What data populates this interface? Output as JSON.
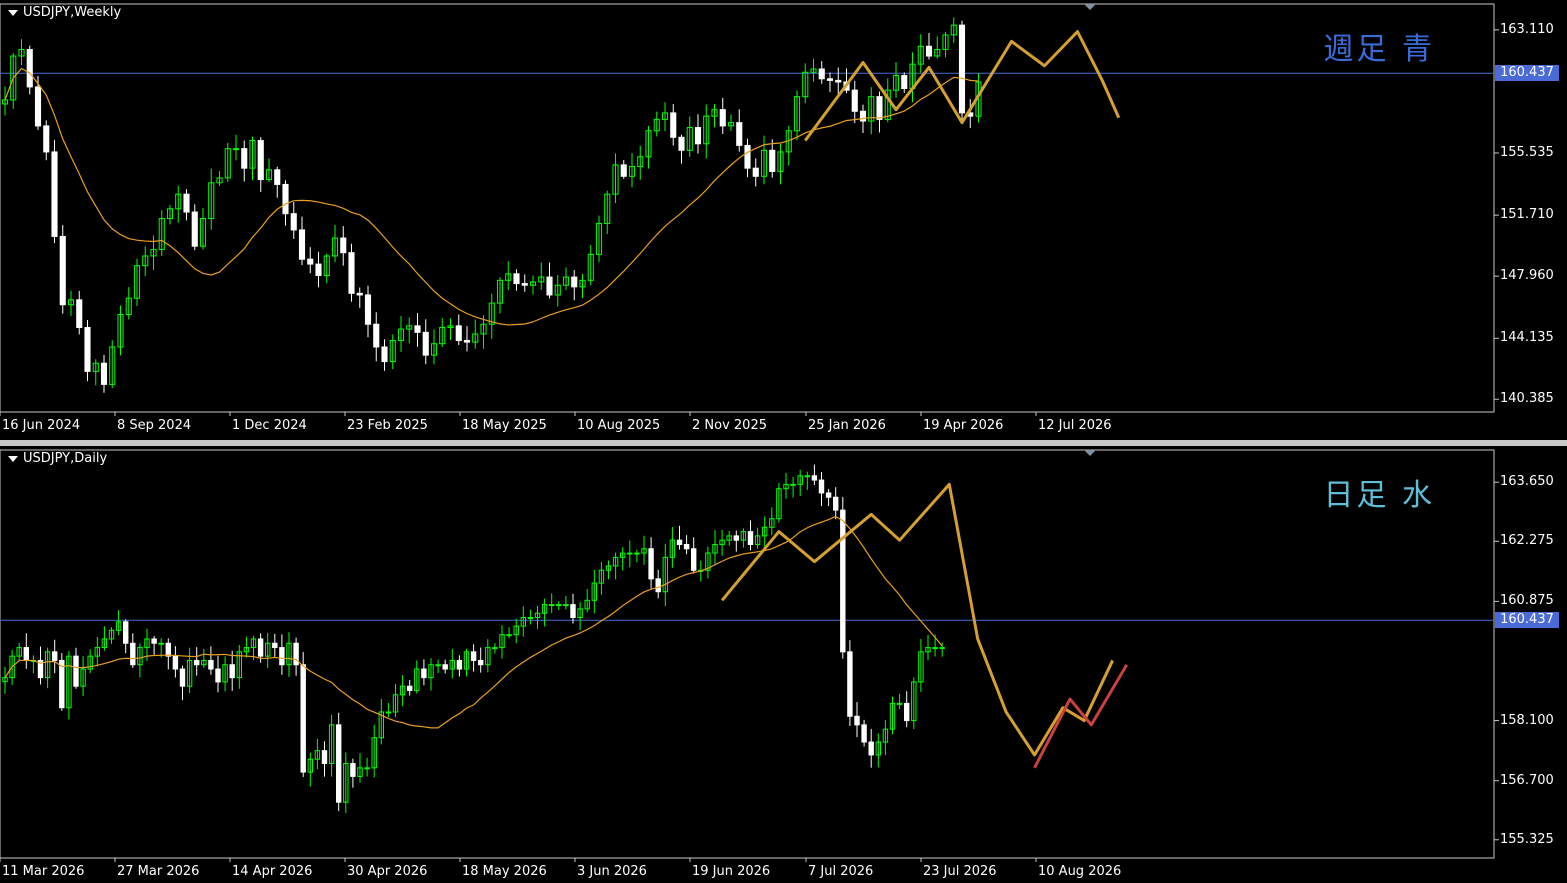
{
  "weekly": {
    "symbol": "USDJPY,Weekly",
    "tag": "週足 青",
    "tag_color": "#3a6cd8",
    "current_price_label": "160.437",
    "price_labels": [
      "163.110",
      "155.535",
      "151.710",
      "147.960",
      "144.135",
      "140.385"
    ],
    "date_labels": [
      "16 Jun 2024",
      "8 Sep 2024",
      "1 Dec 2024",
      "23 Feb 2025",
      "18 May 2025",
      "10 Aug 2025",
      "2 Nov 2025",
      "25 Jan 2026",
      "19 Apr 2026",
      "12 Jul 2026"
    ]
  },
  "daily": {
    "symbol": "USDJPY,Daily",
    "tag": "日足 水",
    "tag_color": "#5fbfd8",
    "current_price_label": "160.437",
    "price_labels": [
      "163.650",
      "162.275",
      "160.875",
      "158.100",
      "156.700",
      "155.325"
    ],
    "date_labels": [
      "11 Mar 2026",
      "27 Mar 2026",
      "14 Apr 2026",
      "30 Apr 2026",
      "18 May 2026",
      "3 Jun 2026",
      "19 Jun 2026",
      "7 Jul 2026",
      "23 Jul 2026",
      "10 Aug 2026"
    ]
  },
  "chart_data": [
    {
      "type": "candlestick",
      "title": "USDJPY,Weekly",
      "ylim": [
        139.6,
        164.7
      ],
      "current_price": 160.437,
      "colors": {
        "up": "#00ff00",
        "down": "#ffffff",
        "ma": "#e8a020",
        "zigzag": "#d4a030",
        "hline": "#4a6ad8"
      },
      "x_ticks": [
        "16 Jun 2024",
        "8 Sep 2024",
        "1 Dec 2024",
        "23 Feb 2025",
        "18 May 2025",
        "10 Aug 2025",
        "2 Nov 2025",
        "25 Jan 2026",
        "19 Apr 2026",
        "12 Jul 2026"
      ],
      "close": [
        158.8,
        161.5,
        161.9,
        159.6,
        157.2,
        155.6,
        150.4,
        146.2,
        146.5,
        144.8,
        142.1,
        142.6,
        141.3,
        143.6,
        145.6,
        146.6,
        148.6,
        149.2,
        149.6,
        151.5,
        152.1,
        153.0,
        151.9,
        149.8,
        151.5,
        153.7,
        154.0,
        155.8,
        155.8,
        154.6,
        156.3,
        153.9,
        154.5,
        153.6,
        151.8,
        150.8,
        149.0,
        148.7,
        148.0,
        149.2,
        150.3,
        149.4,
        146.9,
        146.8,
        145.0,
        143.6,
        142.7,
        144.0,
        144.7,
        144.9,
        144.5,
        143.1,
        143.8,
        144.8,
        144.9,
        144.0,
        143.9,
        144.4,
        145.0,
        146.3,
        147.7,
        148.1,
        147.5,
        147.4,
        147.6,
        147.9,
        146.8,
        147.4,
        147.9,
        147.3,
        147.7,
        149.3,
        151.2,
        153.0,
        154.8,
        154.1,
        154.7,
        155.3,
        156.9,
        157.6,
        158.0,
        156.5,
        155.7,
        157.1,
        156.1,
        157.8,
        158.2,
        157.2,
        157.4,
        156.0,
        154.6,
        154.1,
        155.7,
        154.4,
        155.6,
        156.9,
        159.0,
        160.5,
        160.7,
        160.1,
        160.0,
        159.9,
        159.4,
        158.1,
        157.5,
        159.0,
        157.6,
        159.4,
        160.3,
        159.5,
        161.0,
        162.1,
        161.5,
        161.9,
        162.8,
        163.4,
        158.0,
        157.8,
        159.9
      ],
      "ma_period_note": "",
      "zigzag": [
        [
          97,
          156.3
        ],
        [
          104,
          161.1
        ],
        [
          108,
          158.2
        ],
        [
          112,
          160.8
        ],
        [
          116,
          157.4
        ],
        [
          122,
          162.4
        ],
        [
          126,
          160.9
        ],
        [
          130,
          163.0
        ],
        [
          133,
          160.0
        ],
        [
          135,
          157.7
        ]
      ]
    },
    {
      "type": "candlestick",
      "title": "USDJPY,Daily",
      "ylim": [
        154.9,
        164.4
      ],
      "current_price": 160.437,
      "colors": {
        "up": "#00ff00",
        "down": "#ffffff",
        "ma": "#e8a020",
        "zigzag": "#d4a030",
        "zigzag_2": "#c84040",
        "hline": "#4a6ad8"
      },
      "x_ticks": [
        "11 Mar 2026",
        "27 Mar 2026",
        "14 Apr 2026",
        "30 Apr 2026",
        "18 May 2026",
        "3 Jun 2026",
        "19 Jun 2026",
        "7 Jul 2026",
        "23 Jul 2026",
        "10 Aug 2026"
      ],
      "close": [
        159.1,
        159.6,
        159.8,
        159.5,
        159.5,
        159.1,
        159.7,
        159.5,
        158.4,
        159.6,
        158.9,
        159.3,
        159.6,
        159.8,
        160.0,
        160.2,
        160.4,
        159.9,
        159.4,
        159.8,
        160.0,
        159.9,
        159.9,
        159.6,
        159.3,
        158.9,
        159.5,
        159.4,
        159.5,
        159.3,
        159.0,
        159.4,
        159.1,
        159.7,
        159.8,
        160.0,
        159.6,
        159.9,
        159.8,
        159.4,
        159.9,
        159.4,
        156.9,
        157.2,
        157.4,
        157.1,
        158.0,
        156.2,
        157.1,
        156.8,
        157.0,
        157.0,
        157.7,
        158.3,
        158.3,
        158.7,
        158.9,
        158.8,
        159.3,
        159.1,
        159.4,
        159.4,
        159.3,
        159.5,
        159.3,
        159.7,
        159.5,
        159.4,
        159.8,
        159.8,
        160.1,
        160.1,
        160.3,
        160.5,
        160.5,
        160.6,
        160.8,
        160.8,
        160.8,
        160.8,
        160.5,
        160.7,
        160.9,
        161.3,
        161.6,
        161.7,
        161.9,
        162.0,
        162.0,
        162.0,
        162.1,
        161.4,
        161.1,
        161.9,
        162.3,
        162.2,
        162.1,
        161.6,
        161.6,
        162.0,
        162.2,
        162.3,
        162.4,
        162.3,
        162.5,
        162.2,
        162.4,
        162.6,
        162.8,
        163.5,
        163.6,
        163.6,
        163.8,
        163.8,
        163.7,
        163.4,
        163.3,
        163.0,
        159.7,
        158.2,
        158.0,
        157.6,
        157.3,
        157.6,
        157.9,
        158.5,
        158.5,
        158.1,
        159.0,
        159.7,
        159.8,
        159.8,
        159.8
      ],
      "zigzag": [
        [
          101,
          160.9
        ],
        [
          109,
          162.5
        ],
        [
          114,
          161.8
        ],
        [
          122,
          162.9
        ],
        [
          126,
          162.3
        ],
        [
          133,
          163.6
        ],
        [
          137,
          160.0
        ],
        [
          141,
          158.3
        ],
        [
          145,
          157.3
        ],
        [
          149,
          158.4
        ],
        [
          152,
          158.1
        ],
        [
          156,
          159.5
        ]
      ],
      "zigzag_2": [
        [
          145,
          157.0
        ],
        [
          150,
          158.6
        ],
        [
          153,
          158.0
        ],
        [
          158,
          159.4
        ]
      ]
    }
  ]
}
